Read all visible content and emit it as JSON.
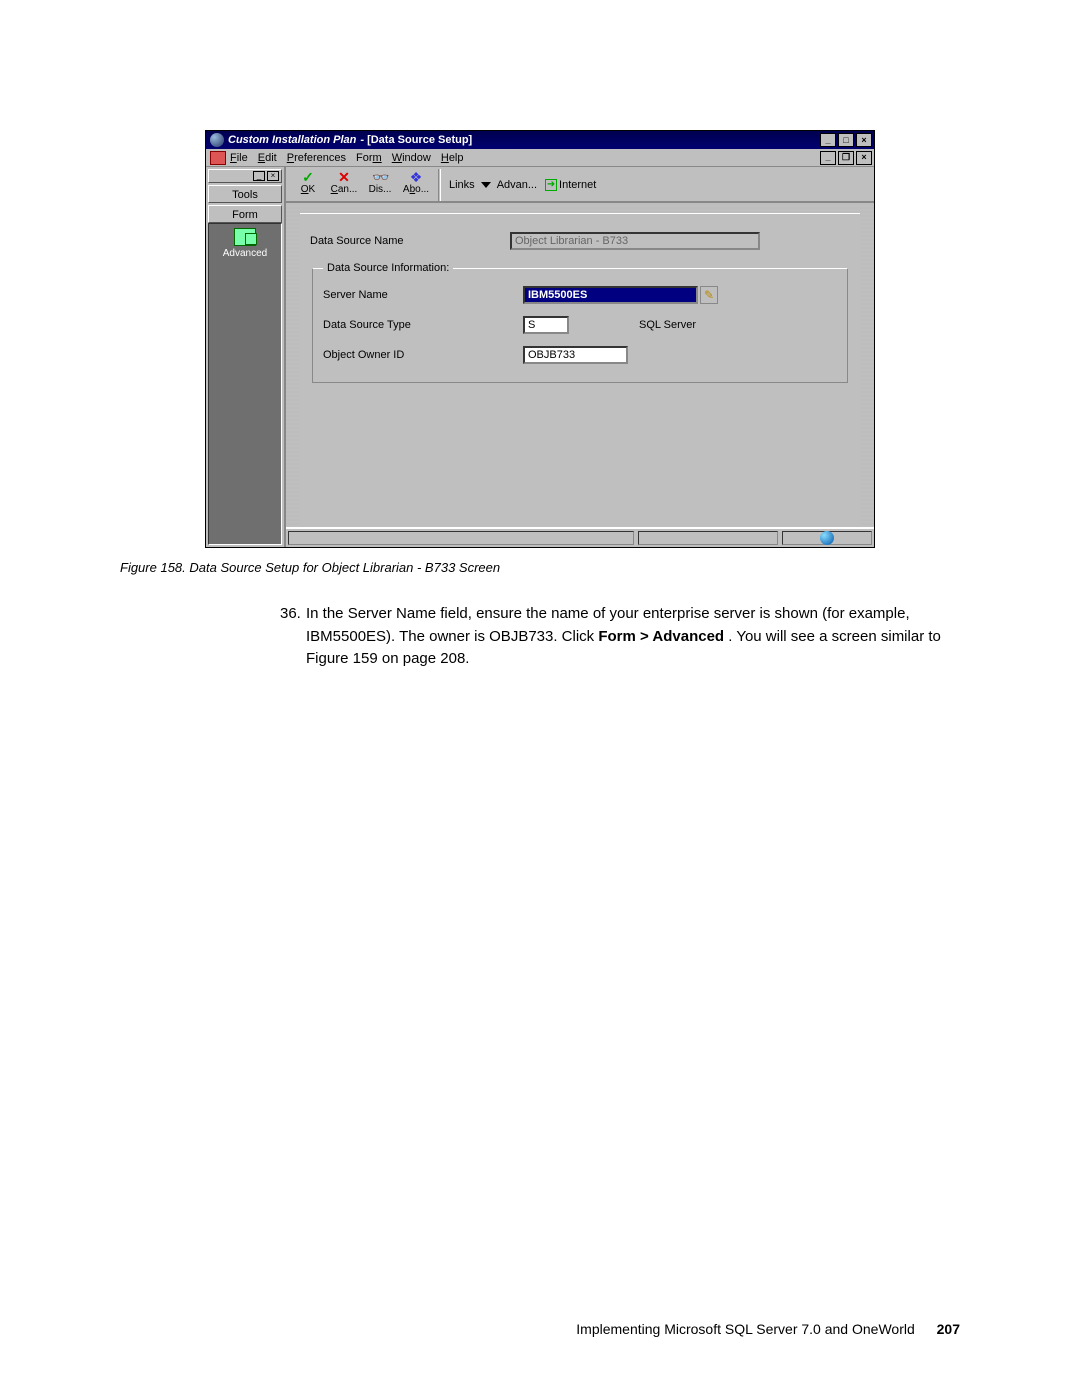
{
  "window": {
    "title_italic": "Custom Installation Plan",
    "title_sub": " - [Data Source Setup]",
    "outer_buttons": {
      "min": "_",
      "max": "□",
      "close": "×"
    },
    "child_buttons": {
      "min": "_",
      "restore": "❐",
      "close": "×"
    }
  },
  "menubar": {
    "items": [
      "File",
      "Edit",
      "Preferences",
      "Form",
      "Window",
      "Help"
    ]
  },
  "sidebar": {
    "tools": "Tools",
    "form": "Form",
    "advanced": "Advanced"
  },
  "toolbar": {
    "ok": "OK",
    "can": "Can...",
    "dis": "Dis...",
    "abo": "Abo...",
    "links": "Links",
    "advan": "Advan...",
    "internet": "Internet"
  },
  "form": {
    "dsn_label": "Data Source Name",
    "dsn_value": "Object Librarian - B733",
    "group_legend": "Data Source Information:",
    "server_label": "Server Name",
    "server_value": "IBM5500ES",
    "dstype_label": "Data Source Type",
    "dstype_code": "S",
    "dstype_text": "SQL Server",
    "owner_label": "Object Owner ID",
    "owner_value": "OBJB733"
  },
  "caption": "Figure 158. Data Source Setup for Object Librarian - B733 Screen",
  "step": {
    "num": "36.",
    "text_a": "In the Server Name field, ensure the name of your enterprise server is shown (for example, IBM5500ES). The owner is OBJB733. Click ",
    "bold": "Form > Advanced",
    "text_b": ". You will see a screen similar to Figure 159 on page 208."
  },
  "footer": {
    "text": "Implementing Microsoft SQL Server 7.0 and OneWorld",
    "page": "207"
  }
}
